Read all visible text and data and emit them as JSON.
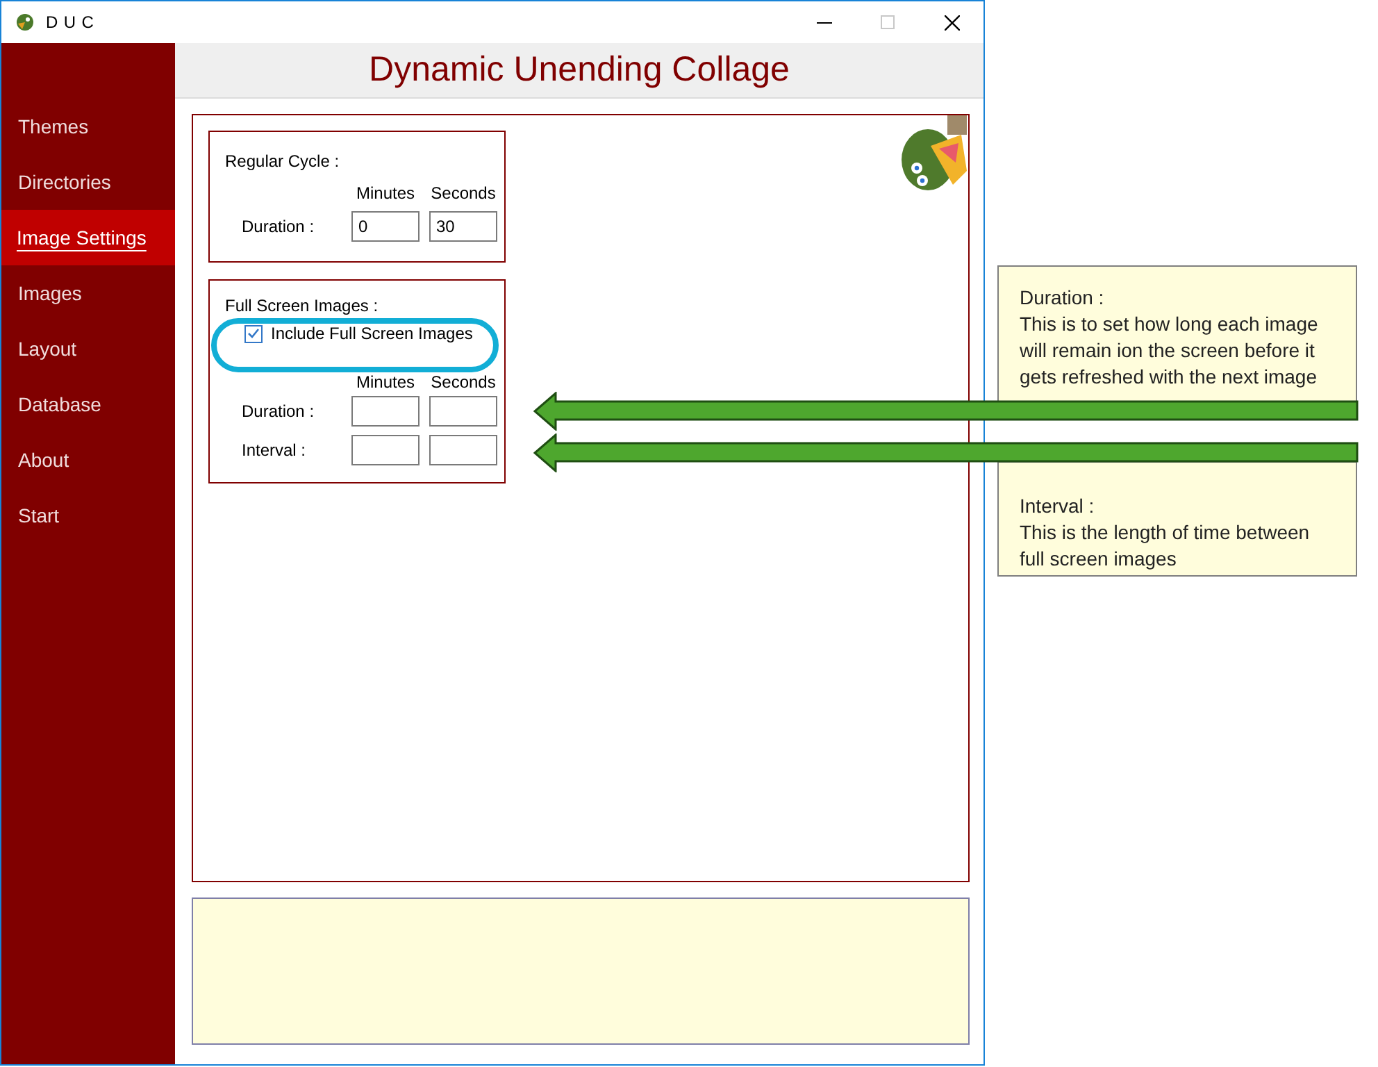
{
  "window": {
    "title": "DUC"
  },
  "app_title": "Dynamic Unending Collage",
  "sidebar": {
    "items": [
      {
        "label": "Themes",
        "selected": false
      },
      {
        "label": "Directories",
        "selected": false
      },
      {
        "label": "Image Settings",
        "selected": true
      },
      {
        "label": "Images",
        "selected": false
      },
      {
        "label": "Layout",
        "selected": false
      },
      {
        "label": "Database",
        "selected": false
      },
      {
        "label": "About",
        "selected": false
      },
      {
        "label": "Start",
        "selected": false
      }
    ]
  },
  "regular_cycle": {
    "title": "Regular Cycle :",
    "columns": [
      "Minutes",
      "Seconds"
    ],
    "rows": [
      {
        "label": "Duration :",
        "minutes": "0",
        "seconds": "30"
      }
    ]
  },
  "full_screen": {
    "title": "Full Screen Images :",
    "checkbox": {
      "label": "Include Full Screen Images",
      "checked": true
    },
    "columns": [
      "Minutes",
      "Seconds"
    ],
    "rows": [
      {
        "label": "Duration :"
      },
      {
        "label": "Interval :"
      }
    ]
  },
  "annotations": [
    {
      "title": "Duration :",
      "text": "This is to set how long each image will remain ion the screen before it gets refreshed with the next image"
    },
    {
      "title": "Interval :",
      "text": "This is the length of time between full screen images"
    }
  ]
}
